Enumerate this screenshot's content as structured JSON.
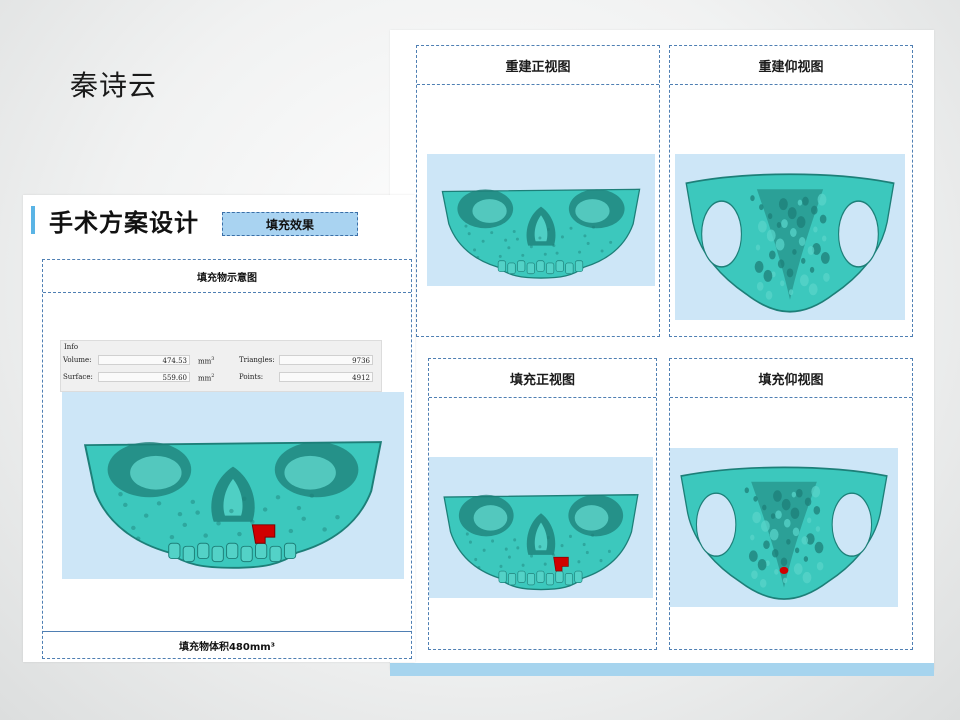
{
  "author": "秦诗云",
  "right_cards": [
    {
      "title": "重建正视图",
      "view": "front",
      "filler": false
    },
    {
      "title": "重建仰视图",
      "view": "bottom",
      "filler": false
    },
    {
      "title": "填充正视图",
      "view": "front",
      "filler": true
    },
    {
      "title": "填充仰视图",
      "view": "bottom",
      "filler": true
    }
  ],
  "plan": {
    "title": "手术方案设计",
    "tag": "填充效果",
    "card_title": "填充物示意图",
    "footer": "填充物体积480mm³",
    "info": {
      "header": "Info",
      "volume_label": "Volume:",
      "volume_value": "474.53",
      "volume_unit": "mm",
      "volume_unit_exp": "3",
      "triangles_label": "Triangles:",
      "triangles_value": "9736",
      "surface_label": "Surface:",
      "surface_value": "559.60",
      "surface_unit": "mm",
      "surface_unit_exp": "2",
      "points_label": "Points:",
      "points_value": "4912"
    }
  },
  "colors": {
    "bone": "#3cc8bd",
    "bone_dark": "#1d7f78",
    "filler": "#d00000",
    "view_bg": "#cde6f7",
    "accent": "#5ab4e5"
  }
}
